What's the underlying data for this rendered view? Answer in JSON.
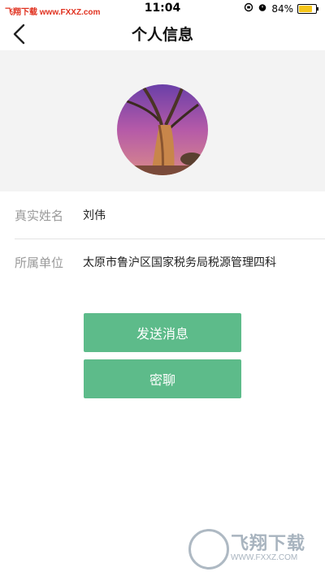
{
  "status_bar": {
    "watermark": "飞翔下载 www.FXXZ.com",
    "time": "11:04",
    "battery_text": "84%",
    "battery_level": 0.84,
    "icons": [
      "orientation-lock-icon",
      "alarm-icon",
      "battery-icon"
    ]
  },
  "header": {
    "title": "个人信息",
    "back_icon": "chevron-left-icon"
  },
  "profile": {
    "avatar": "avatar-image",
    "fields": [
      {
        "label": "真实姓名",
        "value": "刘伟"
      },
      {
        "label": "所属单位",
        "value": "太原市鲁沪区国家税务局税源管理四科"
      }
    ]
  },
  "actions": {
    "send_message": "发送消息",
    "private_chat": "密聊"
  },
  "colors": {
    "accent": "#5dbb8a",
    "avatar_bg": "#f3f3f3"
  },
  "watermark_logo": {
    "text": "飞翔下载",
    "url": "WWW.FXXZ.COM"
  }
}
